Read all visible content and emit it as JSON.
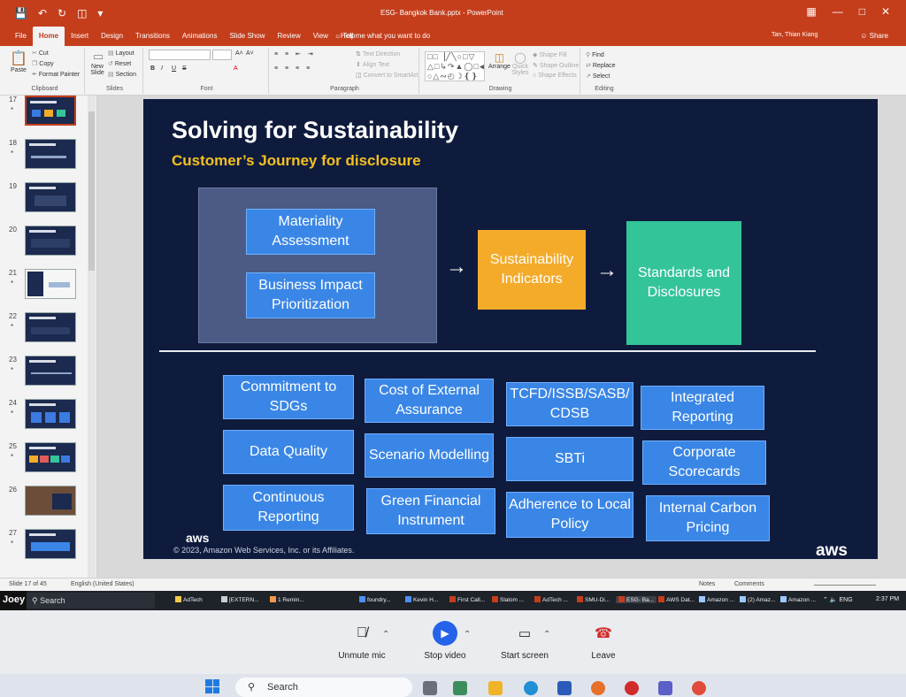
{
  "window": {
    "doc_title": "ESG- Bangkok Bank.pptx  -  PowerPoint",
    "user": "Tan, Thian Kiang",
    "share": "Share",
    "tabs": [
      "File",
      "Home",
      "Insert",
      "Design",
      "Transitions",
      "Animations",
      "Slide Show",
      "Review",
      "View",
      "Help"
    ],
    "active_tab": "Home",
    "tell_me": "Tell me what you want to do"
  },
  "ribbon": {
    "clipboard": {
      "paste": "Paste",
      "cut": "Cut",
      "copy": "Copy",
      "format_painter": "Format Painter",
      "name": "Clipboard"
    },
    "slides": {
      "new_slide": "New Slide",
      "layout": "Layout",
      "reset": "Reset",
      "section": "Section",
      "name": "Slides"
    },
    "font": {
      "name": "Font",
      "bold": "B",
      "italic": "I",
      "underline": "U",
      "strike": "S",
      "grow": "A˄",
      "shrink": "A˅"
    },
    "paragraph": {
      "text_direction": "Text Direction",
      "align_text": "Align Text",
      "convert_smartart": "Convert to SmartArt",
      "name": "Paragraph"
    },
    "drawing": {
      "arrange": "Arrange",
      "quick_styles": "Quick Styles",
      "shape_fill": "Shape Fill",
      "shape_outline": "Shape Outline",
      "shape_effects": "Shape Effects",
      "name": "Drawing"
    },
    "editing": {
      "find": "Find",
      "replace": "Replace",
      "select": "Select",
      "name": "Editing"
    }
  },
  "thumbnails": [
    {
      "num": "17",
      "star": "*"
    },
    {
      "num": "18",
      "star": "*"
    },
    {
      "num": "19",
      "star": ""
    },
    {
      "num": "20",
      "star": ""
    },
    {
      "num": "21",
      "star": "*"
    },
    {
      "num": "22",
      "star": "*"
    },
    {
      "num": "23",
      "star": "*"
    },
    {
      "num": "24",
      "star": "*"
    },
    {
      "num": "25",
      "star": "*"
    },
    {
      "num": "26",
      "star": ""
    },
    {
      "num": "27",
      "star": "*"
    }
  ],
  "selected_thumbnail": "17",
  "slide": {
    "title": "Solving for Sustainability",
    "subtitle": "Customer’s Journey for disclosure",
    "flow": {
      "materiality": "Materiality Assessment",
      "business_impact": "Business Impact Prioritization",
      "indicators": "Sustainability Indicators",
      "standards": "Standards and Disclosures",
      "arrow": "→"
    },
    "grid": [
      "Commitment to SDGs",
      "Cost of External Assurance",
      "TCFD/ISSB/SASB/ CDSB",
      "Integrated Reporting",
      "Data Quality",
      "Scenario Modelling",
      "SBTi",
      "Corporate Scorecards",
      "Continuous Reporting",
      "Green Financial Instrument",
      "Adherence to Local Policy",
      "Internal Carbon Pricing"
    ],
    "aws_small": "aws",
    "copyright": "© 2023, Amazon Web Services, Inc. or its Affiliates.",
    "aws_logo": "aws",
    "colors": {
      "background": "#0f1b3d",
      "box_blue": "#3a86e6",
      "indicator_orange": "#f4ab2a",
      "standards_green": "#33c49a",
      "subtitle_yellow": "#f5c020"
    }
  },
  "status": {
    "slide_of": "Slide 17 of 45",
    "language": "English (United States)",
    "notes": "Notes",
    "comments": "Comments"
  },
  "remote_taskbar": {
    "user_label": "Joey",
    "search": "Search",
    "items": [
      "AdTech",
      "[EXTERN...",
      "1 Remin...",
      "foundry...",
      "Kevin H...",
      "First Call...",
      "Slalom ...",
      "AdTech ...",
      "SMU-Di...",
      "ESG- Ba...",
      "AWS Dat...",
      "Amazon ...",
      "(2) Amaz...",
      "Amazon ..."
    ],
    "active_item": "ESG- Ba...",
    "language": "ENG",
    "time": "2:37 PM"
  },
  "meeting_controls": {
    "unmute": "Unmute mic",
    "stop_video": "Stop video",
    "start_screen": "Start screen",
    "leave": "Leave"
  },
  "local_taskbar": {
    "search": "Search"
  }
}
